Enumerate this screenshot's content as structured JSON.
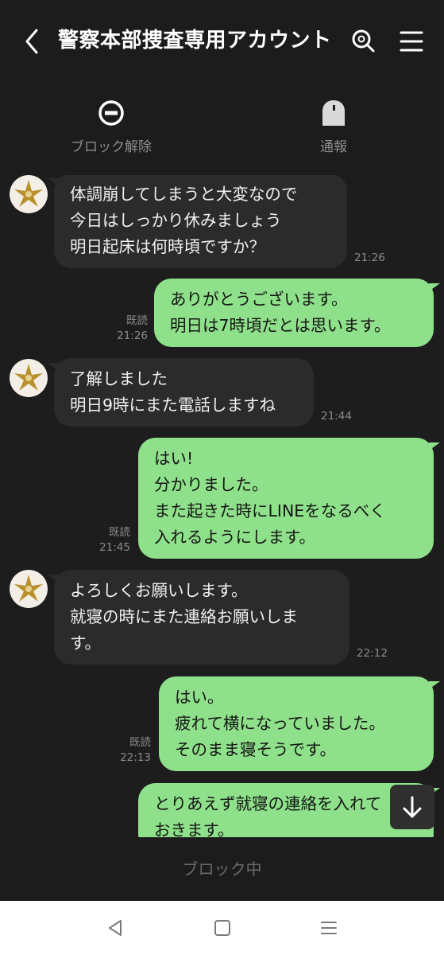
{
  "header": {
    "title": "警察本部捜査専用アカウント"
  },
  "actions": {
    "unblock": "ブロック解除",
    "report": "通報"
  },
  "messages": [
    {
      "side": "in",
      "lines": "体調崩してしまうと大変なので\n今日はしっかり休みましょう\n明日起床は何時頃ですか？",
      "time": "21:26"
    },
    {
      "side": "out",
      "lines": "ありがとうございます。\n明日は7時頃だとは思います。",
      "read": "既読",
      "time": "21:26"
    },
    {
      "side": "in",
      "lines": "了解しました\n明日9時にまた電話しますね",
      "time": "21:44"
    },
    {
      "side": "out",
      "lines": "はい!\n分かりました。\nまた起きた時にLINEをなるべく\n入れるようにします。",
      "read": "既読",
      "time": "21:45"
    },
    {
      "side": "in",
      "lines": "よろしくお願いします。\n就寝の時にまた連絡お願いしま\nす。",
      "time": "22:12"
    },
    {
      "side": "out",
      "lines": "はい。\n疲れて横になっていました。\nそのまま寝そうです。",
      "read": "既読",
      "time": "22:13"
    },
    {
      "side": "out",
      "lines": "とりあえず就寝の連絡を入れて\nおきます。"
    }
  ],
  "footer": {
    "blocked_label": "ブロック中"
  },
  "colors": {
    "outgoing_bubble": "#8fe08a",
    "incoming_bubble": "#2b2b2b",
    "background": "#1c1c1c"
  }
}
